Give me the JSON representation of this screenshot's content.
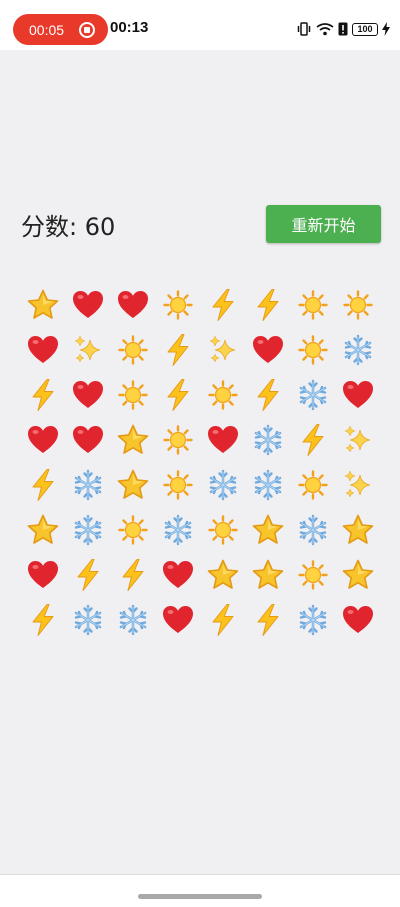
{
  "status_bar": {
    "record_time": "00:05",
    "clock": "00:13",
    "battery": "100"
  },
  "game": {
    "score_text": "分数: 60",
    "restart_label": "重新开始"
  },
  "board": [
    [
      "star",
      "heart",
      "heart",
      "sun",
      "lightning",
      "lightning",
      "sun",
      "sun"
    ],
    [
      "heart",
      "sparkles",
      "sun",
      "lightning",
      "sparkles",
      "heart",
      "sun",
      "snowflake"
    ],
    [
      "lightning",
      "heart",
      "sun",
      "lightning",
      "sun",
      "lightning",
      "snowflake",
      "heart"
    ],
    [
      "heart",
      "heart",
      "star",
      "sun",
      "heart",
      "snowflake",
      "lightning",
      "sparkles"
    ],
    [
      "lightning",
      "snowflake",
      "star",
      "sun",
      "snowflake",
      "snowflake",
      "sun",
      "sparkles"
    ],
    [
      "star",
      "snowflake",
      "sun",
      "snowflake",
      "sun",
      "star",
      "snowflake",
      "star"
    ],
    [
      "heart",
      "lightning",
      "lightning",
      "heart",
      "star",
      "star",
      "sun",
      "star"
    ],
    [
      "lightning",
      "snowflake",
      "snowflake",
      "heart",
      "lightning",
      "lightning",
      "snowflake",
      "heart"
    ]
  ],
  "colors": {
    "restart_button": "#4caf50",
    "record_pill": "#e8392b",
    "background": "#f0eff1"
  }
}
